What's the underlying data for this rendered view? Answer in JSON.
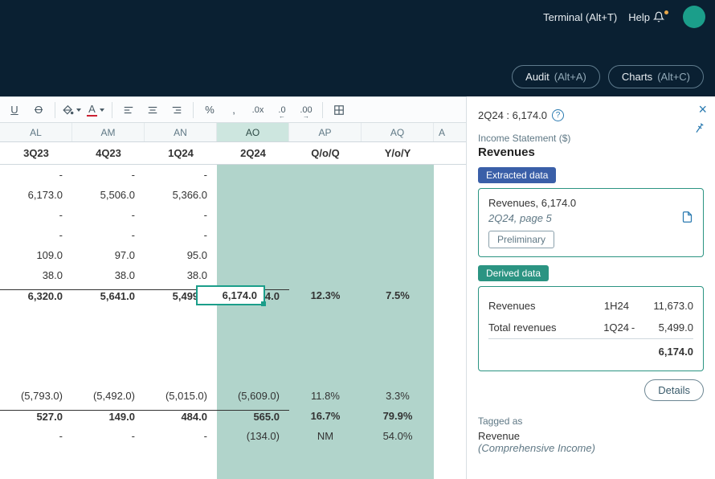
{
  "topbar": {
    "terminal": "Terminal (Alt+T)",
    "help": "Help"
  },
  "tabs": {
    "audit": "Audit",
    "audit_short": "(Alt+A)",
    "charts": "Charts",
    "charts_short": "(Alt+C)"
  },
  "columns_letters": [
    "AL",
    "AM",
    "AN",
    "AO",
    "AP",
    "AQ",
    "A"
  ],
  "columns_labels": [
    "3Q23",
    "4Q23",
    "1Q24",
    "2Q24",
    "Q/o/Q",
    "Y/o/Y"
  ],
  "rows": [
    {
      "c": [
        "-",
        "-",
        "-",
        "",
        "",
        ""
      ]
    },
    {
      "c": [
        "6,173.0",
        "5,506.0",
        "5,366.0",
        "",
        "",
        ""
      ]
    },
    {
      "c": [
        "-",
        "-",
        "-",
        "",
        "",
        ""
      ]
    },
    {
      "c": [
        "-",
        "-",
        "-",
        "",
        "",
        ""
      ]
    },
    {
      "c": [
        "109.0",
        "97.0",
        "95.0",
        "",
        "",
        ""
      ]
    },
    {
      "c": [
        "38.0",
        "38.0",
        "38.0",
        "",
        "",
        ""
      ]
    },
    {
      "c": [
        "6,320.0",
        "5,641.0",
        "5,499.0",
        "6,174.0",
        "12.3%",
        "7.5%"
      ],
      "bold": true,
      "topline": true
    },
    {
      "c": [
        "",
        "",
        "",
        "",
        "",
        ""
      ]
    },
    {
      "c": [
        "",
        "",
        "",
        "",
        "",
        ""
      ]
    },
    {
      "c": [
        "",
        "",
        "",
        "",
        "",
        ""
      ]
    },
    {
      "c": [
        "",
        "",
        "",
        "",
        "",
        ""
      ]
    },
    {
      "c": [
        "(5,793.0)",
        "(5,492.0)",
        "(5,015.0)",
        "(5,609.0)",
        "11.8%",
        "3.3%"
      ]
    },
    {
      "c": [
        "527.0",
        "149.0",
        "484.0",
        "565.0",
        "16.7%",
        "79.9%"
      ],
      "bold": true,
      "topline": true
    },
    {
      "c": [
        "-",
        "-",
        "-",
        "(134.0)",
        "NM",
        "54.0%"
      ]
    }
  ],
  "selected_cell_value": "6,174.0",
  "panel": {
    "kv": "2Q24 : 6,174.0",
    "sub": "Income Statement ($)",
    "title": "Revenues",
    "extracted_badge": "Extracted data",
    "extracted_line1": "Revenues, 6,174.0",
    "extracted_line2": "2Q24, page 5",
    "preliminary": "Preliminary",
    "derived_badge": "Derived data",
    "derived": [
      {
        "label": "Revenues",
        "period": "1H24",
        "op": "",
        "value": "11,673.0"
      },
      {
        "label": "Total revenues",
        "period": "1Q24",
        "op": "-",
        "value": "5,499.0"
      }
    ],
    "derived_total": "6,174.0",
    "details": "Details",
    "tagged_as": "Tagged as",
    "tag1": "Revenue",
    "tag2": "(Comprehensive Income)"
  }
}
